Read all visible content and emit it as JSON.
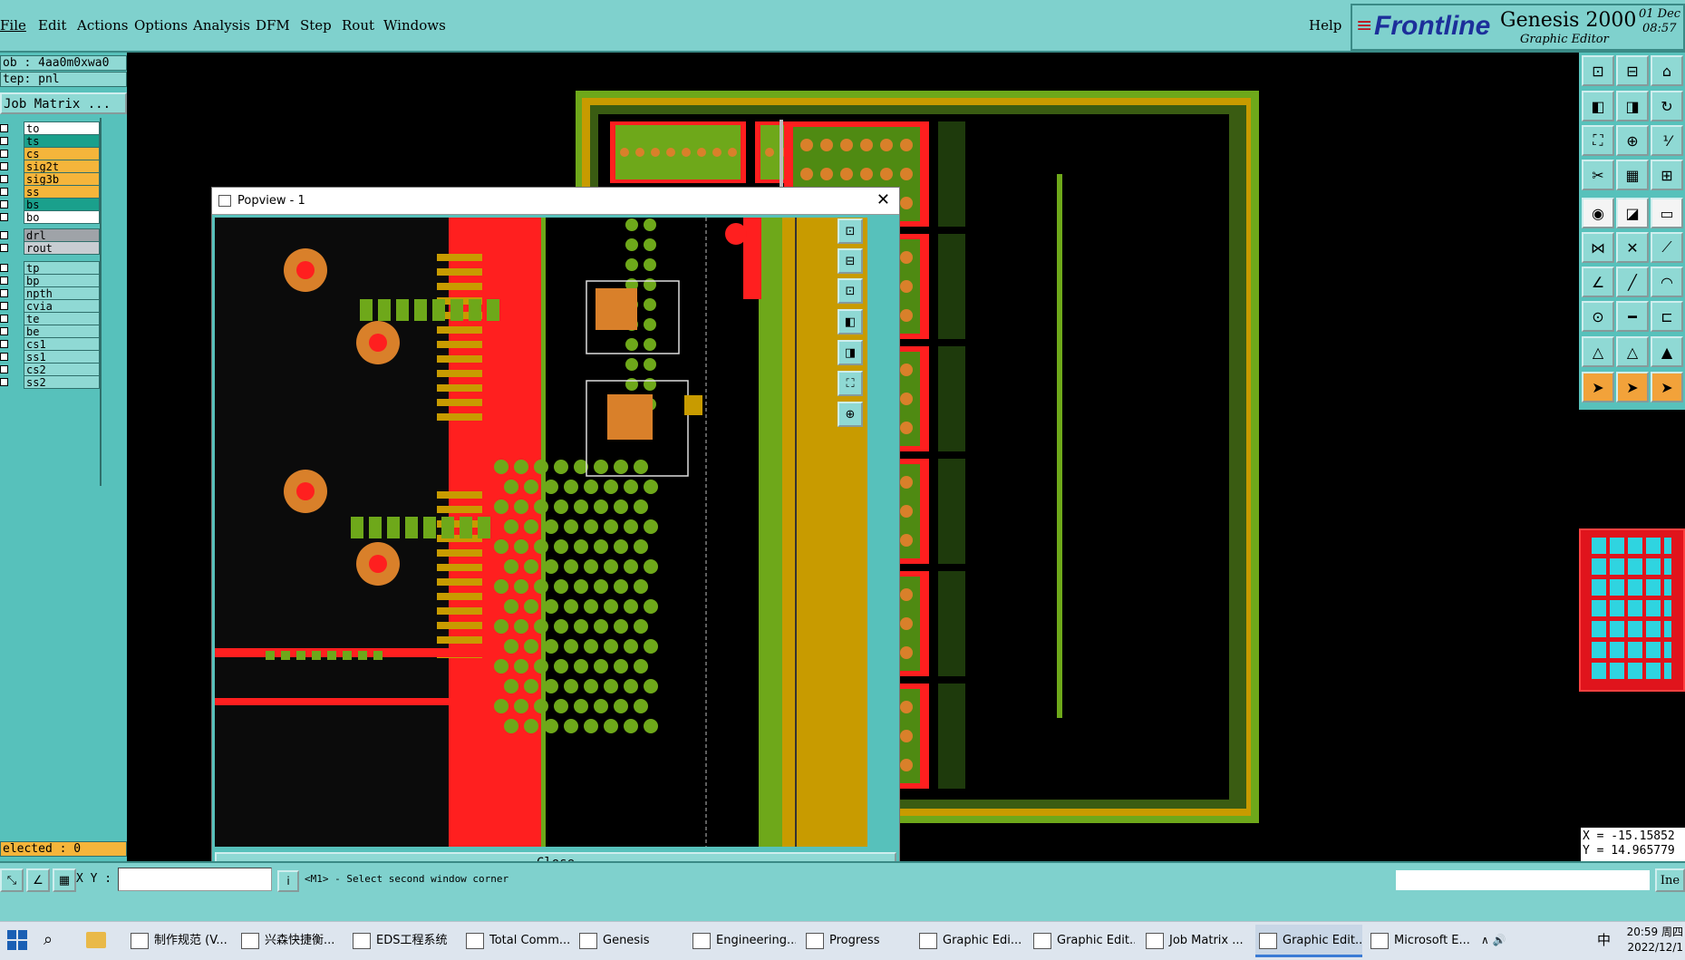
{
  "menu": {
    "items": [
      "File",
      "Edit",
      "Actions",
      "Options",
      "Analysis",
      "DFM",
      "Step",
      "Rout",
      "Windows"
    ],
    "help": "Help"
  },
  "brand": {
    "logo": "Frontline",
    "product": "Genesis 2000",
    "subtitle": "Graphic Editor",
    "date": "01 Dec",
    "time": "08:57"
  },
  "job": {
    "job": "ob : 4aa0m0xwa0",
    "step": "tep: pnl",
    "matrix": "Job Matrix ...",
    "selected": "elected : 0"
  },
  "layers": [
    {
      "name": "to",
      "color": "#ffffff"
    },
    {
      "name": "ts",
      "color": "#1aa08c"
    },
    {
      "name": "cs",
      "color": "#f5b53b"
    },
    {
      "name": "sig2t",
      "color": "#f5b53b"
    },
    {
      "name": "sig3b",
      "color": "#f5b53b"
    },
    {
      "name": "ss",
      "color": "#f5b53b"
    },
    {
      "name": "bs",
      "color": "#1aa08c"
    },
    {
      "name": "bo",
      "color": "#ffffff"
    },
    {
      "name": "drl",
      "color": "#9fa3a8"
    },
    {
      "name": "rout",
      "color": "#c8cdd2"
    },
    {
      "name": "tp",
      "color": "#8fd9d4"
    },
    {
      "name": "bp",
      "color": "#8fd9d4"
    },
    {
      "name": "npth",
      "color": "#8fd9d4"
    },
    {
      "name": "cvia",
      "color": "#8fd9d4"
    },
    {
      "name": "te",
      "color": "#8fd9d4"
    },
    {
      "name": "be",
      "color": "#8fd9d4"
    },
    {
      "name": "cs1",
      "color": "#8fd9d4"
    },
    {
      "name": "ss1",
      "color": "#8fd9d4"
    },
    {
      "name": "cs2",
      "color": "#8fd9d4"
    },
    {
      "name": "ss2",
      "color": "#8fd9d4"
    }
  ],
  "popview": {
    "title": "Popview - 1",
    "close": "Close"
  },
  "coords": {
    "x": "X = -15.15852",
    "y": "Y = 14.965779"
  },
  "status": {
    "xy_label": "X Y :",
    "message": "<M1> - Select second window corner",
    "right_btn": "Ine"
  },
  "taskbar": [
    {
      "label": "制作规范 (V..."
    },
    {
      "label": "兴森快捷衡..."
    },
    {
      "label": "EDS工程系统"
    },
    {
      "label": "Total Comm..."
    },
    {
      "label": "Genesis"
    },
    {
      "label": "Engineering..."
    },
    {
      "label": "Progress"
    },
    {
      "label": "Graphic Edi..."
    },
    {
      "label": "Graphic Edit..."
    },
    {
      "label": "Job Matrix ..."
    },
    {
      "label": "Graphic Edit..."
    },
    {
      "label": "Microsoft E..."
    }
  ],
  "tray": {
    "ime": "中",
    "time": "20:59 周四",
    "date": "2022/12/1"
  },
  "colors": {
    "teal": "#57c1bb",
    "red": "#ff1f1f",
    "green": "#6ea81a",
    "gold": "#c89b00"
  }
}
